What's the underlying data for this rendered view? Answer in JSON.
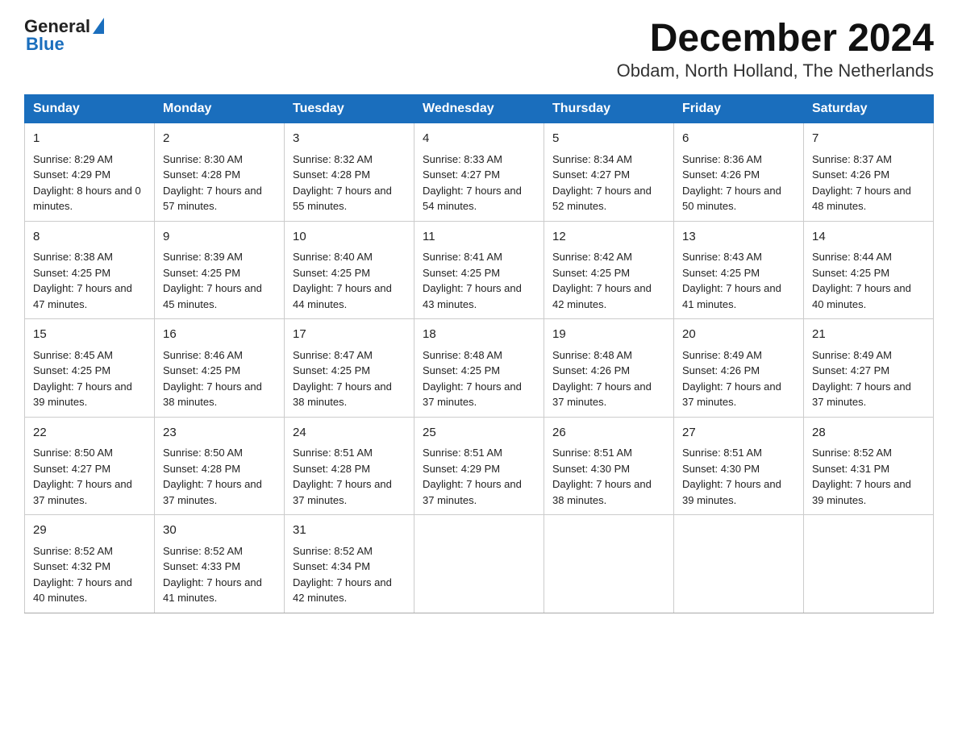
{
  "header": {
    "logo_general": "General",
    "logo_blue": "Blue",
    "title": "December 2024",
    "subtitle": "Obdam, North Holland, The Netherlands"
  },
  "days_of_week": [
    "Sunday",
    "Monday",
    "Tuesday",
    "Wednesday",
    "Thursday",
    "Friday",
    "Saturday"
  ],
  "weeks": [
    [
      {
        "day": "1",
        "sunrise": "8:29 AM",
        "sunset": "4:29 PM",
        "daylight": "8 hours and 0 minutes."
      },
      {
        "day": "2",
        "sunrise": "8:30 AM",
        "sunset": "4:28 PM",
        "daylight": "7 hours and 57 minutes."
      },
      {
        "day": "3",
        "sunrise": "8:32 AM",
        "sunset": "4:28 PM",
        "daylight": "7 hours and 55 minutes."
      },
      {
        "day": "4",
        "sunrise": "8:33 AM",
        "sunset": "4:27 PM",
        "daylight": "7 hours and 54 minutes."
      },
      {
        "day": "5",
        "sunrise": "8:34 AM",
        "sunset": "4:27 PM",
        "daylight": "7 hours and 52 minutes."
      },
      {
        "day": "6",
        "sunrise": "8:36 AM",
        "sunset": "4:26 PM",
        "daylight": "7 hours and 50 minutes."
      },
      {
        "day": "7",
        "sunrise": "8:37 AM",
        "sunset": "4:26 PM",
        "daylight": "7 hours and 48 minutes."
      }
    ],
    [
      {
        "day": "8",
        "sunrise": "8:38 AM",
        "sunset": "4:25 PM",
        "daylight": "7 hours and 47 minutes."
      },
      {
        "day": "9",
        "sunrise": "8:39 AM",
        "sunset": "4:25 PM",
        "daylight": "7 hours and 45 minutes."
      },
      {
        "day": "10",
        "sunrise": "8:40 AM",
        "sunset": "4:25 PM",
        "daylight": "7 hours and 44 minutes."
      },
      {
        "day": "11",
        "sunrise": "8:41 AM",
        "sunset": "4:25 PM",
        "daylight": "7 hours and 43 minutes."
      },
      {
        "day": "12",
        "sunrise": "8:42 AM",
        "sunset": "4:25 PM",
        "daylight": "7 hours and 42 minutes."
      },
      {
        "day": "13",
        "sunrise": "8:43 AM",
        "sunset": "4:25 PM",
        "daylight": "7 hours and 41 minutes."
      },
      {
        "day": "14",
        "sunrise": "8:44 AM",
        "sunset": "4:25 PM",
        "daylight": "7 hours and 40 minutes."
      }
    ],
    [
      {
        "day": "15",
        "sunrise": "8:45 AM",
        "sunset": "4:25 PM",
        "daylight": "7 hours and 39 minutes."
      },
      {
        "day": "16",
        "sunrise": "8:46 AM",
        "sunset": "4:25 PM",
        "daylight": "7 hours and 38 minutes."
      },
      {
        "day": "17",
        "sunrise": "8:47 AM",
        "sunset": "4:25 PM",
        "daylight": "7 hours and 38 minutes."
      },
      {
        "day": "18",
        "sunrise": "8:48 AM",
        "sunset": "4:25 PM",
        "daylight": "7 hours and 37 minutes."
      },
      {
        "day": "19",
        "sunrise": "8:48 AM",
        "sunset": "4:26 PM",
        "daylight": "7 hours and 37 minutes."
      },
      {
        "day": "20",
        "sunrise": "8:49 AM",
        "sunset": "4:26 PM",
        "daylight": "7 hours and 37 minutes."
      },
      {
        "day": "21",
        "sunrise": "8:49 AM",
        "sunset": "4:27 PM",
        "daylight": "7 hours and 37 minutes."
      }
    ],
    [
      {
        "day": "22",
        "sunrise": "8:50 AM",
        "sunset": "4:27 PM",
        "daylight": "7 hours and 37 minutes."
      },
      {
        "day": "23",
        "sunrise": "8:50 AM",
        "sunset": "4:28 PM",
        "daylight": "7 hours and 37 minutes."
      },
      {
        "day": "24",
        "sunrise": "8:51 AM",
        "sunset": "4:28 PM",
        "daylight": "7 hours and 37 minutes."
      },
      {
        "day": "25",
        "sunrise": "8:51 AM",
        "sunset": "4:29 PM",
        "daylight": "7 hours and 37 minutes."
      },
      {
        "day": "26",
        "sunrise": "8:51 AM",
        "sunset": "4:30 PM",
        "daylight": "7 hours and 38 minutes."
      },
      {
        "day": "27",
        "sunrise": "8:51 AM",
        "sunset": "4:30 PM",
        "daylight": "7 hours and 39 minutes."
      },
      {
        "day": "28",
        "sunrise": "8:52 AM",
        "sunset": "4:31 PM",
        "daylight": "7 hours and 39 minutes."
      }
    ],
    [
      {
        "day": "29",
        "sunrise": "8:52 AM",
        "sunset": "4:32 PM",
        "daylight": "7 hours and 40 minutes."
      },
      {
        "day": "30",
        "sunrise": "8:52 AM",
        "sunset": "4:33 PM",
        "daylight": "7 hours and 41 minutes."
      },
      {
        "day": "31",
        "sunrise": "8:52 AM",
        "sunset": "4:34 PM",
        "daylight": "7 hours and 42 minutes."
      },
      null,
      null,
      null,
      null
    ]
  ],
  "labels": {
    "sunrise": "Sunrise:",
    "sunset": "Sunset:",
    "daylight": "Daylight:"
  }
}
